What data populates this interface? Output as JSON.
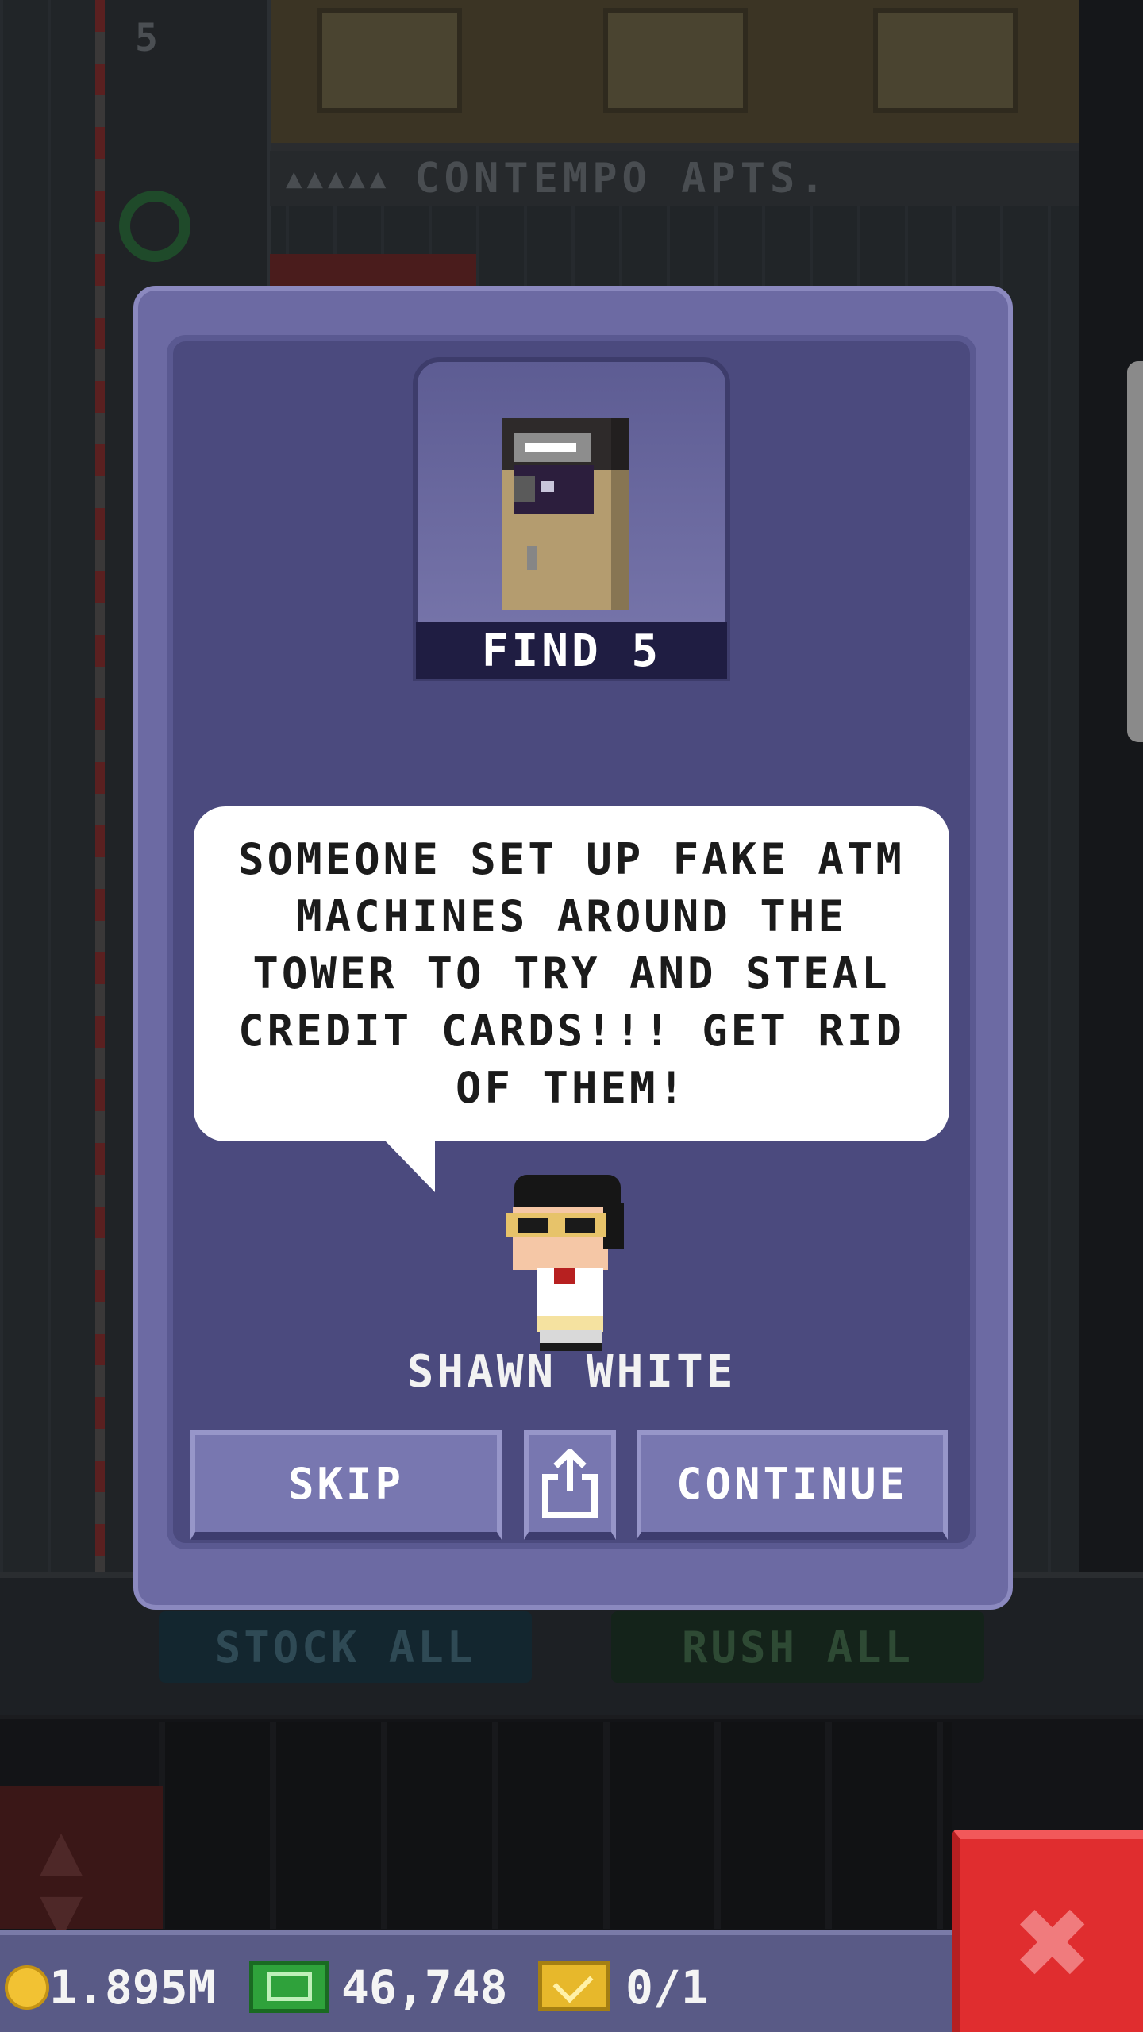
{
  "background": {
    "floor_number": "5",
    "floor_sign": "CONTEMPO APTS.",
    "floor_sign_people": "▲▲▲▲▲",
    "lobby_buttons": {
      "stock_all": "STOCK ALL",
      "rush_all": "RUSH ALL"
    }
  },
  "mission": {
    "item_icon": "atm-machine-icon",
    "find_label": "FIND 5",
    "message": "SOMEONE SET UP FAKE ATM MACHINES AROUND THE TOWER TO TRY AND STEAL CREDIT CARDS!!! GET RID OF THEM!",
    "character_name": "SHAWN WHITE",
    "buttons": {
      "skip": "SKIP",
      "share_icon": "share-icon",
      "continue": "CONTINUE"
    }
  },
  "status_bar": {
    "coins": "1.895M",
    "bux": "46,748",
    "tickets": "0/1"
  },
  "close_icon": "close-icon",
  "colors": {
    "dialog_frame": "#6c6aa3",
    "dialog_inner": "#4b4a7e",
    "button": "#7877b0",
    "close_button": "#e02d2f",
    "status_bar": "#595a86"
  }
}
